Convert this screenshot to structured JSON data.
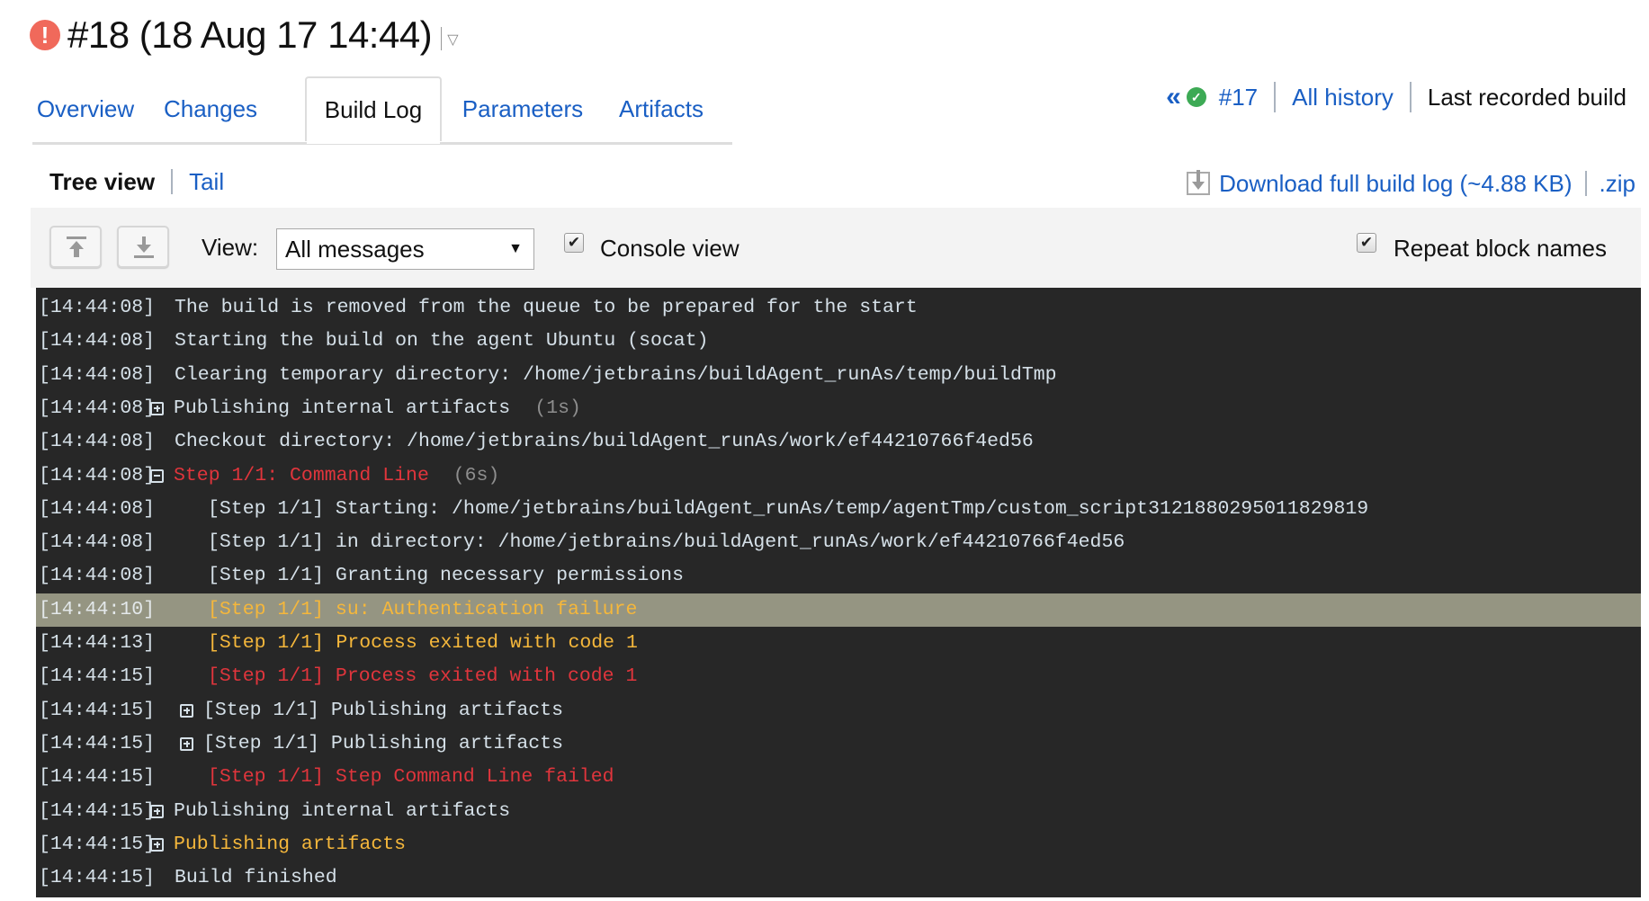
{
  "header": {
    "status_icon": "error-icon",
    "title": "#18 (18 Aug 17 14:44)",
    "dropdown_icon": "▽"
  },
  "tabs": [
    {
      "label": "Overview",
      "active": false
    },
    {
      "label": "Changes",
      "active": false
    },
    {
      "label": "Build Log",
      "active": true
    },
    {
      "label": "Parameters",
      "active": false
    },
    {
      "label": "Artifacts",
      "active": false
    }
  ],
  "build_nav": {
    "prev_icon": "«",
    "prev_status_icon": "success-check-icon",
    "prev_build": "#17",
    "all_history": "All history",
    "last_recorded": "Last recorded build"
  },
  "subnav": {
    "tree_view": "Tree view",
    "tail": "Tail"
  },
  "download": {
    "label": "Download full build log (~4.88 KB)",
    "zip": ".zip"
  },
  "toolbar": {
    "scroll_top_tooltip": "scroll-to-top",
    "scroll_bottom_tooltip": "scroll-to-bottom",
    "view_label": "View:",
    "view_selected": "All messages",
    "console_view_label": "Console view",
    "console_view_checked": true,
    "repeat_block_names_label": "Repeat block names",
    "repeat_block_names_checked": true
  },
  "colors": {
    "log_bg": "#272727",
    "highlight_bg": "#959582",
    "link": "#1a5fc4",
    "error": "#e0353c",
    "warning": "#f5b73b",
    "success": "#3daa55",
    "failure_badge": "#f0695b"
  },
  "log": [
    {
      "time": "[14:44:08]",
      "indent": 0,
      "toggle": null,
      "parts": [
        {
          "text": "The build is removed from the queue to be prepared for the start",
          "color": "norm"
        }
      ]
    },
    {
      "time": "[14:44:08]",
      "indent": 0,
      "toggle": null,
      "parts": [
        {
          "text": "Starting the build on the agent Ubuntu (socat)",
          "color": "norm"
        }
      ]
    },
    {
      "time": "[14:44:08]",
      "indent": 0,
      "toggle": null,
      "parts": [
        {
          "text": "Clearing temporary directory: /home/jetbrains/buildAgent_runAs/temp/buildTmp",
          "color": "norm"
        }
      ]
    },
    {
      "time": "[14:44:08]",
      "indent": 0,
      "toggle": "plus",
      "parts": [
        {
          "text": "Publishing internal artifacts",
          "color": "norm"
        },
        {
          "text": "  (1s)",
          "color": "gray"
        }
      ]
    },
    {
      "time": "[14:44:08]",
      "indent": 0,
      "toggle": null,
      "parts": [
        {
          "text": "Checkout directory: /home/jetbrains/buildAgent_runAs/work/ef44210766f4ed56",
          "color": "norm"
        }
      ]
    },
    {
      "time": "[14:44:08]",
      "indent": 0,
      "toggle": "minus",
      "parts": [
        {
          "text": "Step 1/1: Command Line",
          "color": "red"
        },
        {
          "text": "  (6s)",
          "color": "gray"
        }
      ]
    },
    {
      "time": "[14:44:08]",
      "indent": 1,
      "toggle": null,
      "parts": [
        {
          "text": "[Step 1/1] Starting: /home/jetbrains/buildAgent_runAs/temp/agentTmp/custom_script3121880295011829819",
          "color": "norm"
        }
      ]
    },
    {
      "time": "[14:44:08]",
      "indent": 1,
      "toggle": null,
      "parts": [
        {
          "text": "[Step 1/1] in directory: /home/jetbrains/buildAgent_runAs/work/ef44210766f4ed56",
          "color": "norm"
        }
      ]
    },
    {
      "time": "[14:44:08]",
      "indent": 1,
      "toggle": null,
      "parts": [
        {
          "text": "[Step 1/1] Granting necessary permissions",
          "color": "norm"
        }
      ]
    },
    {
      "time": "[14:44:10]",
      "indent": 1,
      "toggle": null,
      "highlight": true,
      "parts": [
        {
          "text": "[Step 1/1] su: Authentication failure",
          "color": "yel"
        }
      ]
    },
    {
      "time": "[14:44:13]",
      "indent": 1,
      "toggle": null,
      "parts": [
        {
          "text": "[Step 1/1]",
          "color": "yel"
        },
        {
          "text": " Process exited with code 1",
          "color": "yel"
        }
      ]
    },
    {
      "time": "[14:44:15]",
      "indent": 1,
      "toggle": null,
      "parts": [
        {
          "text": "[Step 1/1] Process exited with code 1",
          "color": "red"
        }
      ]
    },
    {
      "time": "[14:44:15]",
      "indent": 1,
      "toggle": "plus",
      "parts": [
        {
          "text": "[Step 1/1] Publishing artifacts",
          "color": "norm"
        }
      ]
    },
    {
      "time": "[14:44:15]",
      "indent": 1,
      "toggle": "plus",
      "parts": [
        {
          "text": "[Step 1/1] Publishing artifacts",
          "color": "norm"
        }
      ]
    },
    {
      "time": "[14:44:15]",
      "indent": 1,
      "toggle": null,
      "parts": [
        {
          "text": "[Step 1/1] Step Command Line failed",
          "color": "red"
        }
      ]
    },
    {
      "time": "[14:44:15]",
      "indent": 0,
      "toggle": "plus",
      "parts": [
        {
          "text": "Publishing internal artifacts",
          "color": "norm"
        }
      ]
    },
    {
      "time": "[14:44:15]",
      "indent": 0,
      "toggle": "plus",
      "parts": [
        {
          "text": "Publishing artifacts",
          "color": "yel"
        }
      ]
    },
    {
      "time": "[14:44:15]",
      "indent": 0,
      "toggle": null,
      "parts": [
        {
          "text": "Build finished",
          "color": "norm"
        }
      ]
    }
  ]
}
